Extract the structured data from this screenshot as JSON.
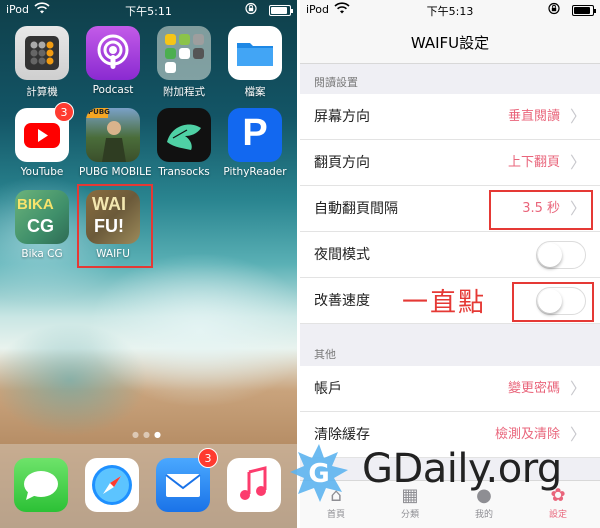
{
  "left_phone": {
    "status": {
      "carrier": "iPod",
      "time": "下午5:11"
    },
    "apps": [
      {
        "label": "計算機"
      },
      {
        "label": "Podcast"
      },
      {
        "label": "附加程式"
      },
      {
        "label": "檔案"
      },
      {
        "label": "YouTube",
        "badge": "3"
      },
      {
        "label": "PUBG MOBILE"
      },
      {
        "label": "Transocks"
      },
      {
        "label": "PithyReader"
      },
      {
        "label": "Bika CG"
      },
      {
        "label": "WAIFU"
      }
    ],
    "icon_text": {
      "pubg": "PUBG",
      "pithy": "P",
      "bika_top": "BIKA",
      "bika_bottom": "CG",
      "waifu_top": "WAI",
      "waifu_bottom": "FU!"
    },
    "dock": {
      "mail_badge": "3"
    }
  },
  "right_phone": {
    "status": {
      "carrier": "iPod",
      "time": "下午5:13"
    },
    "nav_title": "WAIFU設定",
    "sections": [
      {
        "header": "閱讀設置",
        "rows": [
          {
            "title": "屏幕方向",
            "value": "垂直閱讀"
          },
          {
            "title": "翻頁方向",
            "value": "上下翻頁"
          },
          {
            "title": "自動翻頁間隔",
            "value": "3.5 秒"
          },
          {
            "title": "夜間模式"
          },
          {
            "title": "改善速度"
          }
        ]
      },
      {
        "header": "其他",
        "rows": [
          {
            "title": "帳戶",
            "value": "變更密碼"
          },
          {
            "title": "清除緩存",
            "value": "檢測及清除"
          }
        ]
      }
    ],
    "annotation": "一直點",
    "tabs": [
      {
        "label": "首頁"
      },
      {
        "label": "分類"
      },
      {
        "label": "我的"
      },
      {
        "label": "設定"
      }
    ]
  },
  "watermark": {
    "logo_letter": "G",
    "text": "GDaily.org"
  },
  "colors": {
    "accent": "#e9657b",
    "highlight_red": "#e53935",
    "badge_red": "#ff3b30"
  }
}
